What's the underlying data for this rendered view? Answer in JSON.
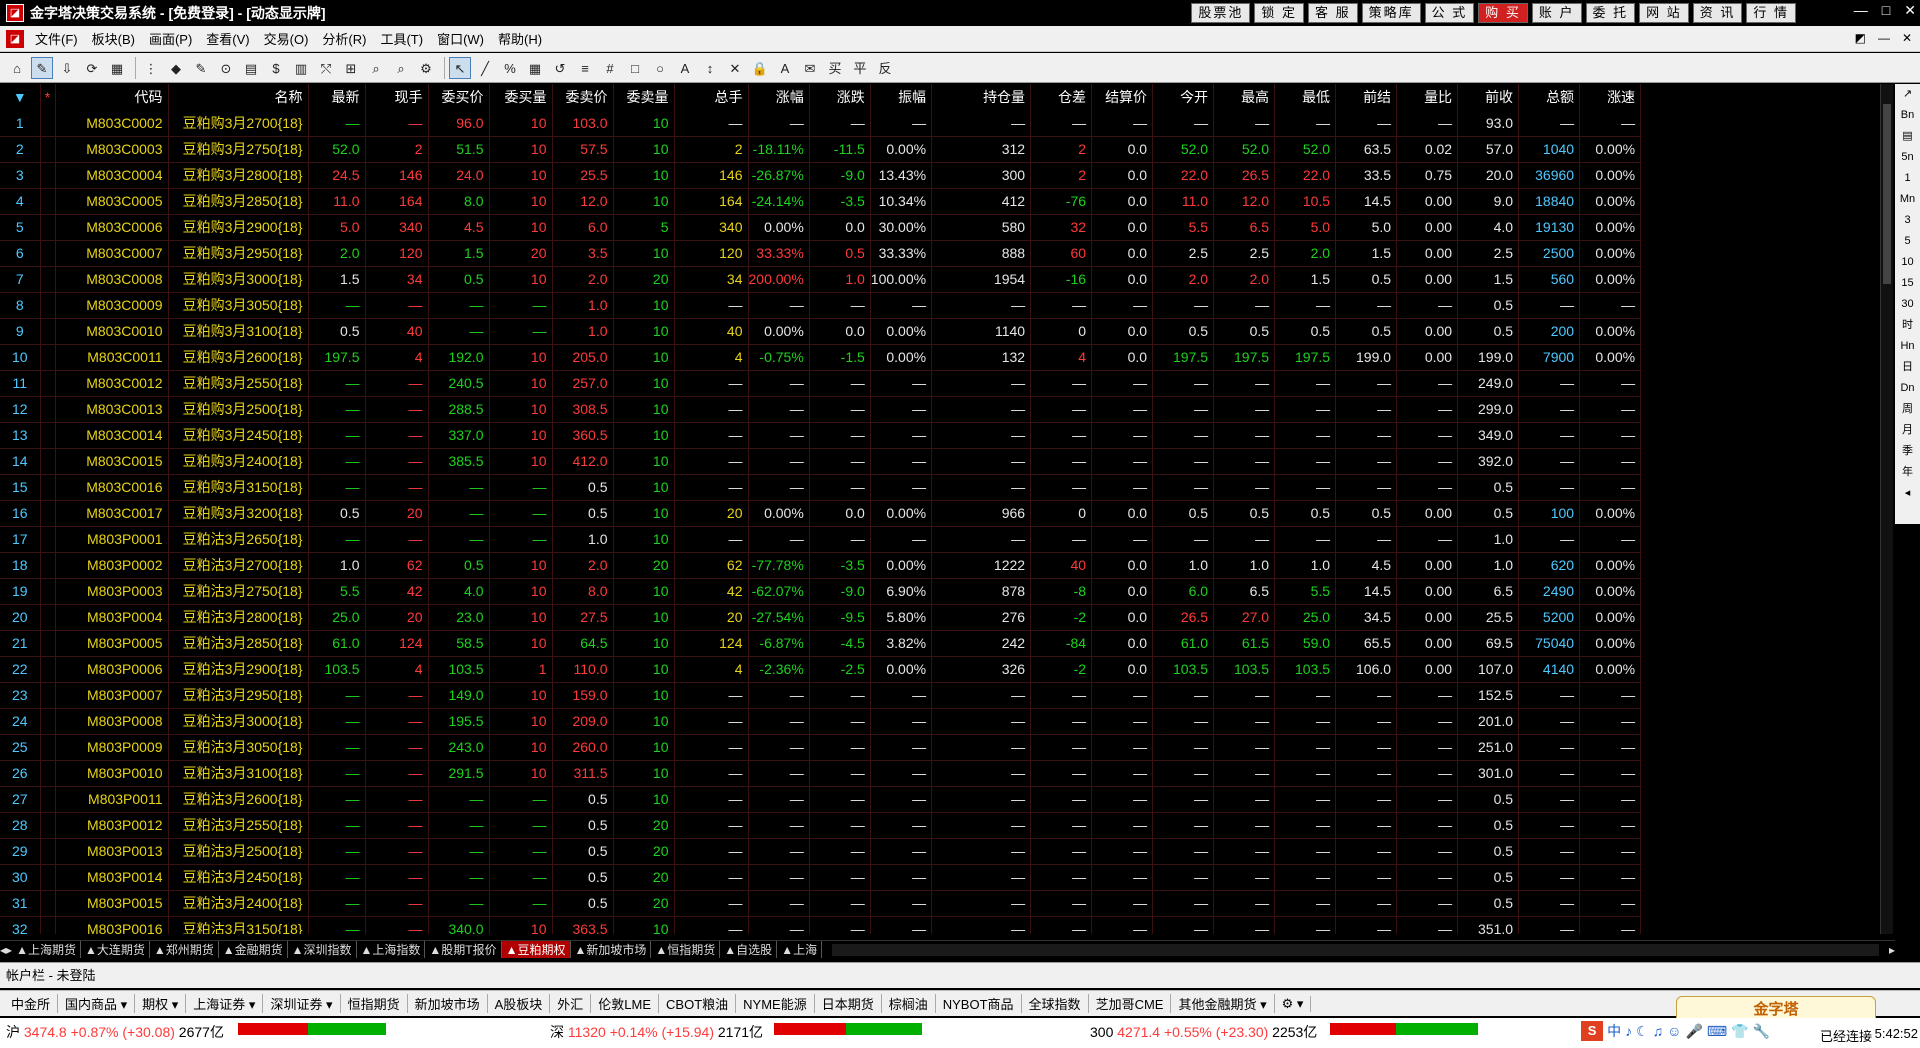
{
  "title": {
    "text": "金字塔决策交易系统 - [免费登录] - [动态显示牌]"
  },
  "topbuttons": [
    "股票池",
    "锁 定",
    "客 服",
    "策略库",
    "公 式",
    "购 买",
    "账 户",
    "委 托",
    "网 站",
    "资 讯",
    "行 情"
  ],
  "wincontrols": [
    "—",
    "□",
    "✕"
  ],
  "menu": [
    "文件(F)",
    "板块(B)",
    "画面(P)",
    "查看(V)",
    "交易(O)",
    "分析(R)",
    "工具(T)",
    "窗口(W)",
    "帮助(H)"
  ],
  "mdi": [
    "◩",
    "—",
    "✕"
  ],
  "toolbar_icons": [
    "⌂",
    "✎",
    "⇩",
    "⟳",
    "▦",
    "⋮",
    "◆",
    "✎",
    "⊙",
    "▤",
    "$",
    "▥",
    "⤲",
    "⊞",
    "⌕",
    "⌕",
    "⚙",
    "↖",
    "╱",
    "%",
    "▦",
    "↺",
    "≡",
    "#",
    "□",
    "○",
    "A",
    "↕",
    "✕",
    "🔒",
    "A",
    "✉",
    "买",
    "平",
    "反"
  ],
  "columns": [
    "*",
    "代码",
    "名称",
    "最新",
    "现手",
    "委买价",
    "委买量",
    "委卖价",
    "委卖量",
    "总手",
    "涨幅",
    "涨跌",
    "振幅",
    "持仓量",
    "仓差",
    "结算价",
    "今开",
    "最高",
    "最低",
    "前结",
    "量比",
    "前收",
    "总额",
    "涨速"
  ],
  "rows": [
    [
      "1",
      "M803C0002",
      "豆粕购3月2700{18}",
      "—",
      "—",
      "96.0",
      "10",
      "103.0",
      "10",
      "—",
      "—",
      "—",
      "—",
      "—",
      "—",
      "—",
      "—",
      "—",
      "—",
      "—",
      "—",
      "93.0",
      "—",
      "—"
    ],
    [
      "2",
      "M803C0003",
      "豆粕购3月2750{18}",
      "52.0",
      "2",
      "51.5",
      "10",
      "57.5",
      "10",
      "2",
      "-18.11%",
      "-11.5",
      "0.00%",
      "312",
      "2",
      "0.0",
      "52.0",
      "52.0",
      "52.0",
      "63.5",
      "0.02",
      "57.0",
      "1040",
      "0.00%"
    ],
    [
      "3",
      "M803C0004",
      "豆粕购3月2800{18}",
      "24.5",
      "146",
      "24.0",
      "10",
      "25.5",
      "10",
      "146",
      "-26.87%",
      "-9.0",
      "13.43%",
      "300",
      "2",
      "0.0",
      "22.0",
      "26.5",
      "22.0",
      "33.5",
      "0.75",
      "20.0",
      "36960",
      "0.00%"
    ],
    [
      "4",
      "M803C0005",
      "豆粕购3月2850{18}",
      "11.0",
      "164",
      "8.0",
      "10",
      "12.0",
      "10",
      "164",
      "-24.14%",
      "-3.5",
      "10.34%",
      "412",
      "-76",
      "0.0",
      "11.0",
      "12.0",
      "10.5",
      "14.5",
      "0.00",
      "9.0",
      "18840",
      "0.00%"
    ],
    [
      "5",
      "M803C0006",
      "豆粕购3月2900{18}",
      "5.0",
      "340",
      "4.5",
      "10",
      "6.0",
      "5",
      "340",
      "0.00%",
      "0.0",
      "30.00%",
      "580",
      "32",
      "0.0",
      "5.5",
      "6.5",
      "5.0",
      "5.0",
      "0.00",
      "4.0",
      "19130",
      "0.00%"
    ],
    [
      "6",
      "M803C0007",
      "豆粕购3月2950{18}",
      "2.0",
      "120",
      "1.5",
      "20",
      "3.5",
      "10",
      "120",
      "33.33%",
      "0.5",
      "33.33%",
      "888",
      "60",
      "0.0",
      "2.5",
      "2.5",
      "2.0",
      "1.5",
      "0.00",
      "2.5",
      "2500",
      "0.00%"
    ],
    [
      "7",
      "M803C0008",
      "豆粕购3月3000{18}",
      "1.5",
      "34",
      "0.5",
      "10",
      "2.0",
      "20",
      "34",
      "200.00%",
      "1.0",
      "100.00%",
      "1954",
      "-16",
      "0.0",
      "2.0",
      "2.0",
      "1.5",
      "0.5",
      "0.00",
      "1.5",
      "560",
      "0.00%"
    ],
    [
      "8",
      "M803C0009",
      "豆粕购3月3050{18}",
      "—",
      "—",
      "—",
      "—",
      "1.0",
      "10",
      "—",
      "—",
      "—",
      "—",
      "—",
      "—",
      "—",
      "—",
      "—",
      "—",
      "—",
      "—",
      "0.5",
      "—",
      "—"
    ],
    [
      "9",
      "M803C0010",
      "豆粕购3月3100{18}",
      "0.5",
      "40",
      "—",
      "—",
      "1.0",
      "10",
      "40",
      "0.00%",
      "0.0",
      "0.00%",
      "1140",
      "0",
      "0.0",
      "0.5",
      "0.5",
      "0.5",
      "0.5",
      "0.00",
      "0.5",
      "200",
      "0.00%"
    ],
    [
      "10",
      "M803C0011",
      "豆粕购3月2600{18}",
      "197.5",
      "4",
      "192.0",
      "10",
      "205.0",
      "10",
      "4",
      "-0.75%",
      "-1.5",
      "0.00%",
      "132",
      "4",
      "0.0",
      "197.5",
      "197.5",
      "197.5",
      "199.0",
      "0.00",
      "199.0",
      "7900",
      "0.00%"
    ],
    [
      "11",
      "M803C0012",
      "豆粕购3月2550{18}",
      "—",
      "—",
      "240.5",
      "10",
      "257.0",
      "10",
      "—",
      "—",
      "—",
      "—",
      "—",
      "—",
      "—",
      "—",
      "—",
      "—",
      "—",
      "—",
      "249.0",
      "—",
      "—"
    ],
    [
      "12",
      "M803C0013",
      "豆粕购3月2500{18}",
      "—",
      "—",
      "288.5",
      "10",
      "308.5",
      "10",
      "—",
      "—",
      "—",
      "—",
      "—",
      "—",
      "—",
      "—",
      "—",
      "—",
      "—",
      "—",
      "299.0",
      "—",
      "—"
    ],
    [
      "13",
      "M803C0014",
      "豆粕购3月2450{18}",
      "—",
      "—",
      "337.0",
      "10",
      "360.5",
      "10",
      "—",
      "—",
      "—",
      "—",
      "—",
      "—",
      "—",
      "—",
      "—",
      "—",
      "—",
      "—",
      "349.0",
      "—",
      "—"
    ],
    [
      "14",
      "M803C0015",
      "豆粕购3月2400{18}",
      "—",
      "—",
      "385.5",
      "10",
      "412.0",
      "10",
      "—",
      "—",
      "—",
      "—",
      "—",
      "—",
      "—",
      "—",
      "—",
      "—",
      "—",
      "—",
      "392.0",
      "—",
      "—"
    ],
    [
      "15",
      "M803C0016",
      "豆粕购3月3150{18}",
      "—",
      "—",
      "—",
      "—",
      "0.5",
      "10",
      "—",
      "—",
      "—",
      "—",
      "—",
      "—",
      "—",
      "—",
      "—",
      "—",
      "—",
      "—",
      "0.5",
      "—",
      "—"
    ],
    [
      "16",
      "M803C0017",
      "豆粕购3月3200{18}",
      "0.5",
      "20",
      "—",
      "—",
      "0.5",
      "10",
      "20",
      "0.00%",
      "0.0",
      "0.00%",
      "966",
      "0",
      "0.0",
      "0.5",
      "0.5",
      "0.5",
      "0.5",
      "0.00",
      "0.5",
      "100",
      "0.00%"
    ],
    [
      "17",
      "M803P0001",
      "豆粕沽3月2650{18}",
      "—",
      "—",
      "—",
      "—",
      "1.0",
      "10",
      "—",
      "—",
      "—",
      "—",
      "—",
      "—",
      "—",
      "—",
      "—",
      "—",
      "—",
      "—",
      "1.0",
      "—",
      "—"
    ],
    [
      "18",
      "M803P0002",
      "豆粕沽3月2700{18}",
      "1.0",
      "62",
      "0.5",
      "10",
      "2.0",
      "20",
      "62",
      "-77.78%",
      "-3.5",
      "0.00%",
      "1222",
      "40",
      "0.0",
      "1.0",
      "1.0",
      "1.0",
      "4.5",
      "0.00",
      "1.0",
      "620",
      "0.00%"
    ],
    [
      "19",
      "M803P0003",
      "豆粕沽3月2750{18}",
      "5.5",
      "42",
      "4.0",
      "10",
      "8.0",
      "10",
      "42",
      "-62.07%",
      "-9.0",
      "6.90%",
      "878",
      "-8",
      "0.0",
      "6.0",
      "6.5",
      "5.5",
      "14.5",
      "0.00",
      "6.5",
      "2490",
      "0.00%"
    ],
    [
      "20",
      "M803P0004",
      "豆粕沽3月2800{18}",
      "25.0",
      "20",
      "23.0",
      "10",
      "27.5",
      "10",
      "20",
      "-27.54%",
      "-9.5",
      "5.80%",
      "276",
      "-2",
      "0.0",
      "26.5",
      "27.0",
      "25.0",
      "34.5",
      "0.00",
      "25.5",
      "5200",
      "0.00%"
    ],
    [
      "21",
      "M803P0005",
      "豆粕沽3月2850{18}",
      "61.0",
      "124",
      "58.5",
      "10",
      "64.5",
      "10",
      "124",
      "-6.87%",
      "-4.5",
      "3.82%",
      "242",
      "-84",
      "0.0",
      "61.0",
      "61.5",
      "59.0",
      "65.5",
      "0.00",
      "69.5",
      "75040",
      "0.00%"
    ],
    [
      "22",
      "M803P0006",
      "豆粕沽3月2900{18}",
      "103.5",
      "4",
      "103.5",
      "1",
      "110.0",
      "10",
      "4",
      "-2.36%",
      "-2.5",
      "0.00%",
      "326",
      "-2",
      "0.0",
      "103.5",
      "103.5",
      "103.5",
      "106.0",
      "0.00",
      "107.0",
      "4140",
      "0.00%"
    ],
    [
      "23",
      "M803P0007",
      "豆粕沽3月2950{18}",
      "—",
      "—",
      "149.0",
      "10",
      "159.0",
      "10",
      "—",
      "—",
      "—",
      "—",
      "—",
      "—",
      "—",
      "—",
      "—",
      "—",
      "—",
      "—",
      "152.5",
      "—",
      "—"
    ],
    [
      "24",
      "M803P0008",
      "豆粕沽3月3000{18}",
      "—",
      "—",
      "195.5",
      "10",
      "209.0",
      "10",
      "—",
      "—",
      "—",
      "—",
      "—",
      "—",
      "—",
      "—",
      "—",
      "—",
      "—",
      "—",
      "201.0",
      "—",
      "—"
    ],
    [
      "25",
      "M803P0009",
      "豆粕沽3月3050{18}",
      "—",
      "—",
      "243.0",
      "10",
      "260.0",
      "10",
      "—",
      "—",
      "—",
      "—",
      "—",
      "—",
      "—",
      "—",
      "—",
      "—",
      "—",
      "—",
      "251.0",
      "—",
      "—"
    ],
    [
      "26",
      "M803P0010",
      "豆粕沽3月3100{18}",
      "—",
      "—",
      "291.5",
      "10",
      "311.5",
      "10",
      "—",
      "—",
      "—",
      "—",
      "—",
      "—",
      "—",
      "—",
      "—",
      "—",
      "—",
      "—",
      "301.0",
      "—",
      "—"
    ],
    [
      "27",
      "M803P0011",
      "豆粕沽3月2600{18}",
      "—",
      "—",
      "—",
      "—",
      "0.5",
      "10",
      "—",
      "—",
      "—",
      "—",
      "—",
      "—",
      "—",
      "—",
      "—",
      "—",
      "—",
      "—",
      "0.5",
      "—",
      "—"
    ],
    [
      "28",
      "M803P0012",
      "豆粕沽3月2550{18}",
      "—",
      "—",
      "—",
      "—",
      "0.5",
      "20",
      "—",
      "—",
      "—",
      "—",
      "—",
      "—",
      "—",
      "—",
      "—",
      "—",
      "—",
      "—",
      "0.5",
      "—",
      "—"
    ],
    [
      "29",
      "M803P0013",
      "豆粕沽3月2500{18}",
      "—",
      "—",
      "—",
      "—",
      "0.5",
      "20",
      "—",
      "—",
      "—",
      "—",
      "—",
      "—",
      "—",
      "—",
      "—",
      "—",
      "—",
      "—",
      "0.5",
      "—",
      "—"
    ],
    [
      "30",
      "M803P0014",
      "豆粕沽3月2450{18}",
      "—",
      "—",
      "—",
      "—",
      "0.5",
      "20",
      "—",
      "—",
      "—",
      "—",
      "—",
      "—",
      "—",
      "—",
      "—",
      "—",
      "—",
      "—",
      "0.5",
      "—",
      "—"
    ],
    [
      "31",
      "M803P0015",
      "豆粕沽3月2400{18}",
      "—",
      "—",
      "—",
      "—",
      "0.5",
      "20",
      "—",
      "—",
      "—",
      "—",
      "—",
      "—",
      "—",
      "—",
      "—",
      "—",
      "—",
      "—",
      "0.5",
      "—",
      "—"
    ],
    [
      "32",
      "M803P0016",
      "豆粕沽3月3150{18}",
      "—",
      "—",
      "340.0",
      "10",
      "363.5",
      "10",
      "—",
      "—",
      "—",
      "—",
      "—",
      "—",
      "—",
      "—",
      "—",
      "—",
      "—",
      "—",
      "351.0",
      "—",
      "—"
    ]
  ],
  "sheet_tabs": [
    "▲上海期货",
    "▲大连期货",
    "▲郑州期货",
    "▲金融期货",
    "▲深圳指数",
    "▲上海指数",
    "▲股期T报价",
    "▲豆粕期权",
    "▲新加坡市场",
    "▲恒指期货",
    "▲自选股",
    "▲上海"
  ],
  "active_sheet": "▲豆粕期权",
  "rightbar": [
    "↗",
    "Bn",
    "▤",
    "5n",
    "1",
    "Mn",
    "3",
    "5",
    "10",
    "15",
    "30",
    "时",
    "Hn",
    "日",
    "Dn",
    "周",
    "月",
    "季",
    "年",
    "◂"
  ],
  "account": {
    "text": "帐户栏 - 未登陆"
  },
  "market_tabs": [
    "中金所",
    "国内商品 ▾",
    "期权 ▾",
    "上海证券 ▾",
    "深圳证券 ▾",
    "恒指期货",
    "新加坡市场",
    "A股板块",
    "外汇",
    "伦敦LME",
    "CBOT粮油",
    "NYME能源",
    "日本期货",
    "棕榈油",
    "NYBOT商品",
    "全球指数",
    "芝加哥CME",
    "其他金融期货 ▾",
    "⚙ ▾"
  ],
  "ad": {
    "text": "金字塔"
  },
  "status": {
    "sh_label": "沪",
    "sh_value": "3474.8",
    "sh_change": "+0.87% (+30.08)",
    "sh_amount": "2677亿",
    "sz_label": "深",
    "sz_value": "11320",
    "sz_change": "+0.14% (+15.94)",
    "sz_amount": "2171亿",
    "hs_label": "300",
    "hs_value": "4271.4",
    "hs_change": "+0.55% (+23.30)",
    "hs_amount": "2253亿",
    "conn": "已经连接",
    "time": "5:42:52"
  },
  "tray_icons": [
    "S",
    "中",
    "♪",
    "☾",
    "♫",
    "☺",
    "🎤",
    "⌨",
    "👕",
    "🔧"
  ],
  "colors": {
    "up": "#ff3a3a",
    "down": "#1ed21e",
    "code": "#e8d418",
    "index": "#4ec9ff"
  }
}
